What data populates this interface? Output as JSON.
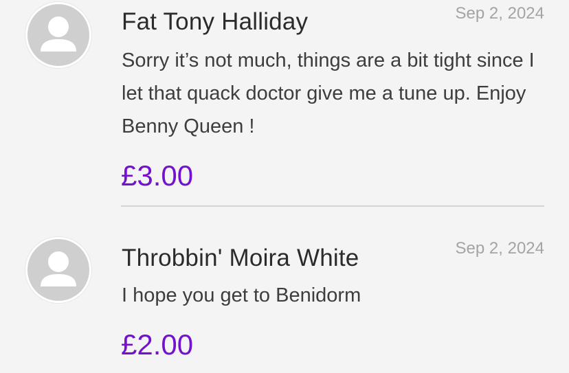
{
  "donations": [
    {
      "name": "Fat Tony Halliday",
      "date": "Sep 2, 2024",
      "message": "Sorry it’s not much, things are a bit tight since I let that quack doctor give me a tune up. Enjoy Benny Queen !",
      "amount": "£3.00"
    },
    {
      "name": "Throbbin' Moira White",
      "date": "Sep 2, 2024",
      "message": "I hope you get to Benidorm",
      "amount": "£2.00"
    }
  ],
  "avatar_icon": "default-user-icon",
  "colors": {
    "background": "#f4f4f4",
    "amount": "#7411cc",
    "date": "#a4a4a4",
    "divider": "#d4d4d4"
  }
}
